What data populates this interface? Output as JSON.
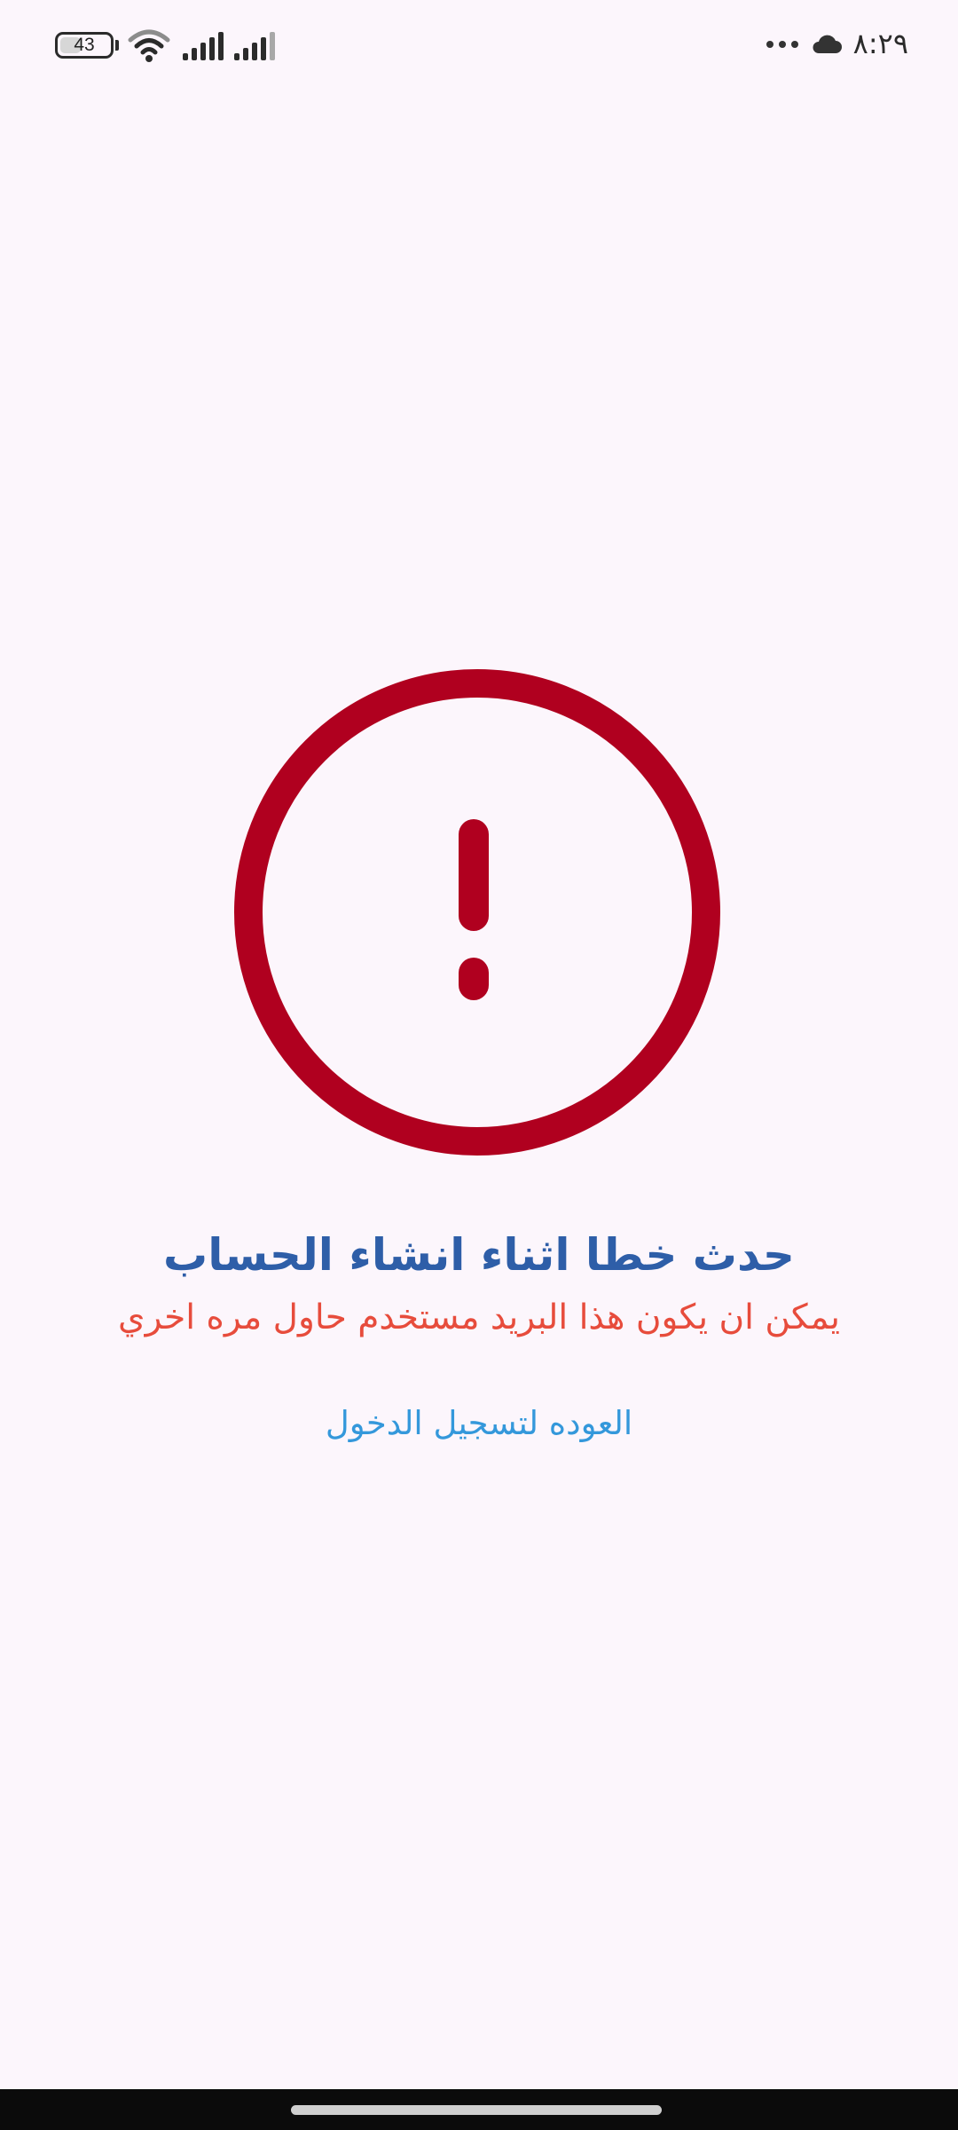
{
  "status_bar": {
    "battery_level": "43",
    "battery_fraction": 0.43,
    "time": "٨:٢٩",
    "icons": [
      "battery-icon",
      "wifi-icon",
      "signal-icon",
      "signal-icon",
      "more-icon",
      "cloud-icon"
    ]
  },
  "error": {
    "icon": "error-icon",
    "title": "حدث خطا اثناء انشاء الحساب",
    "message": "يمكن ان يكون هذا البريد مستخدم حاول مره اخري",
    "back_link": "العوده لتسجيل الدخول"
  },
  "colors": {
    "background": "#fcf6fc",
    "error_icon": "#b0001f",
    "title": "#2e5ea8",
    "message": "#e74c3c",
    "link": "#3498db",
    "nav_bar": "#0b0b0b"
  }
}
